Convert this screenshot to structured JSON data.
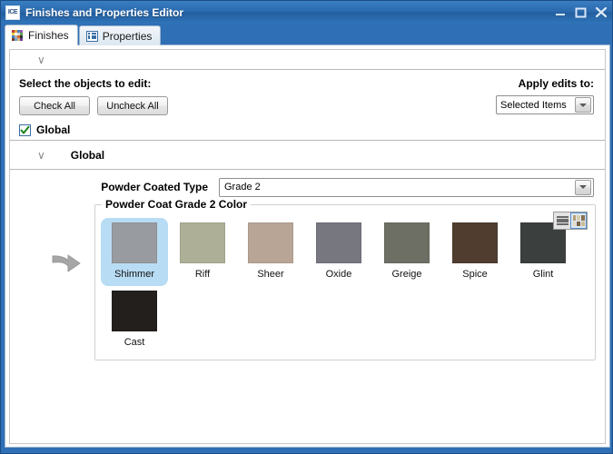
{
  "window": {
    "title": "Finishes and Properties Editor",
    "app_icon": "ice-app-icon",
    "buttons": {
      "minimize": "minimize-icon",
      "maximize": "maximize-icon",
      "close": "close-icon"
    }
  },
  "tabs": [
    {
      "label": "Finishes",
      "icon": "color-grid-icon",
      "active": true
    },
    {
      "label": "Properties",
      "icon": "list-icon",
      "active": false
    }
  ],
  "collapse": {
    "chevron": "∨"
  },
  "select_section": {
    "heading": "Select the objects to edit:",
    "check_all": "Check All",
    "uncheck_all": "Uncheck All",
    "global_checkbox": {
      "label": "Global",
      "checked": true,
      "check_glyph": "✔"
    },
    "apply": {
      "label": "Apply edits to:",
      "value": "Selected Items",
      "arrow": "chevron-down-icon"
    }
  },
  "global_group": {
    "chevron": "∨",
    "title": "Global"
  },
  "powder_type": {
    "label": "Powder Coated Type",
    "value": "Grade 2",
    "arrow": "chevron-down-icon"
  },
  "swatch_group": {
    "legend": "Powder Coat Grade 2 Color",
    "view_toggle": {
      "list_view": "list-view-icon",
      "thumbnail_view": "thumbnail-view-icon",
      "selected": "thumbnail_view"
    },
    "pointer": "arrow-pointer-icon",
    "selected_swatch": "Shimmer",
    "swatches": [
      {
        "name": "Shimmer",
        "color": "#989ca0",
        "selected": true
      },
      {
        "name": "Riff",
        "color": "#adaf96",
        "selected": false
      },
      {
        "name": "Sheer",
        "color": "#b8a596",
        "selected": false
      },
      {
        "name": "Oxide",
        "color": "#76777f",
        "selected": false
      },
      {
        "name": "Greige",
        "color": "#6d6f64",
        "selected": false
      },
      {
        "name": "Spice",
        "color": "#503d2f",
        "selected": false
      },
      {
        "name": "Glint",
        "color": "#3b3f3e",
        "selected": false
      },
      {
        "name": "Cast",
        "color": "#231f1d",
        "selected": false
      }
    ]
  },
  "theme": {
    "titlebar_blue": "#2a69ae",
    "selection_blue": "#b8dcf4",
    "border_gray": "#c8c8c8"
  }
}
